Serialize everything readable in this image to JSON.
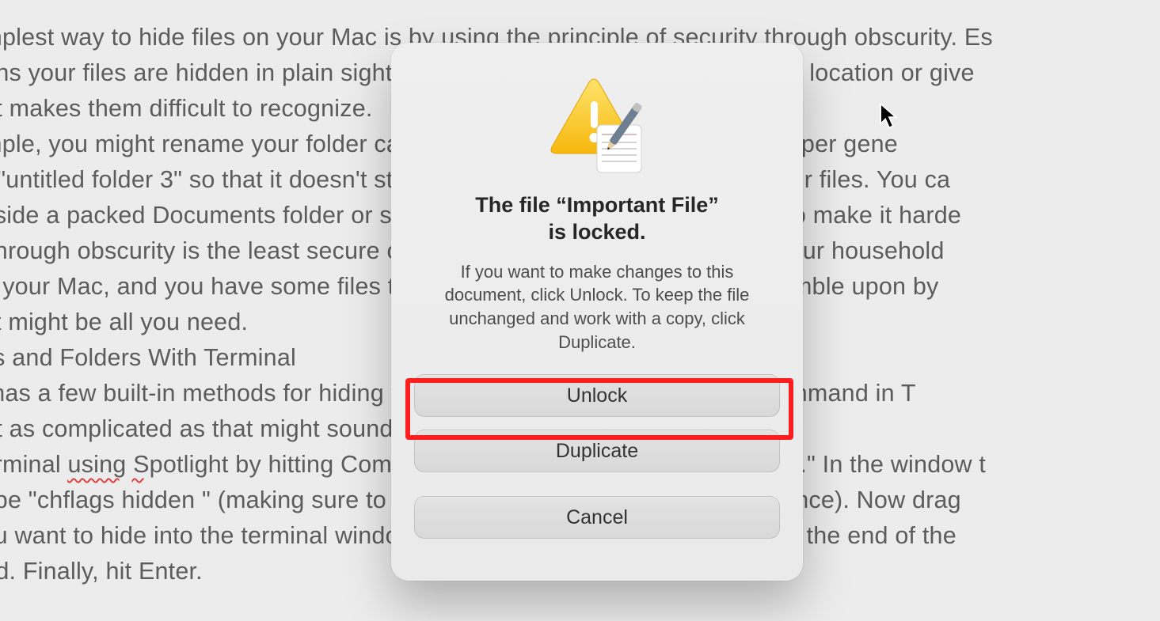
{
  "background": {
    "text": "mplest way to hide files on your Mac is by using the principle of security through obscurity. Es\neans your files are hidden in plain sight. You just store them in a less obvious location or give\nhat makes them difficult to recognize.\nample, you might rename your folder called \"Browsing Data\" to something super gene\nor \"untitled folder 3\" so that it doesn't stand out to anyone poking through your files. You ca\n inside a packed Documents folder or some subfolder of your Library folder to make it harde\ny through obscurity is the least secure option on this list, but if someone in your household\n to your Mac, and you have some files that you'd rather not want them to stumble upon by\nt, it might be all you need.\niles and Folders With Terminal\nS has a few built-in methods for hiding files, and one of them works via a command in T\nnot as complicated as that might sound.\nTerminal using Spotlight by hitting Command+Space and searching \"terminal.\" In the window t\n type \"chflags hidden \" (making sure to leave a space at the end of the sentence). Now drag\nyou want to hide into the terminal window. This will add the path to that file to the end of the\nand. Finally, hit Enter.",
    "misspelled_word": "chflags"
  },
  "dialog": {
    "title_line1": "The file “Important File”",
    "title_line2": "is locked.",
    "message": "If you want to make changes to this document, click Unlock. To keep the file unchanged and work with a copy, click Duplicate.",
    "buttons": {
      "unlock": "Unlock",
      "duplicate": "Duplicate",
      "cancel": "Cancel"
    },
    "icon": "warning-textedit"
  },
  "annotation": {
    "highlight_target": "unlock-button"
  },
  "cursor": {
    "type": "arrow"
  }
}
